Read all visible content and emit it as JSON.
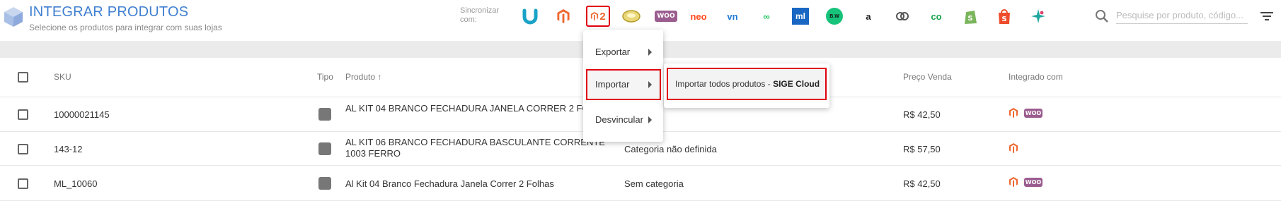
{
  "header": {
    "title": "INTEGRAR PRODUTOS",
    "subtitle": "Selecione os produtos para integrar com suas lojas",
    "sync_label": "Sincronizar com:",
    "search_placeholder": "Pesquise por produto, código..."
  },
  "integrations": [
    {
      "name": "u-icon",
      "text": "",
      "color": "#1aa3c7"
    },
    {
      "name": "magento-icon",
      "text": "",
      "color": "#ee672f"
    },
    {
      "name": "magento2-icon",
      "text": "2",
      "color": "#ee672f"
    },
    {
      "name": "plate-icon",
      "text": "",
      "color": "#d9c24b"
    },
    {
      "name": "woocommerce-icon",
      "text": "WOO",
      "color": "#9b5c8f"
    },
    {
      "name": "neo-icon",
      "text": "neo",
      "color": "#ff4a1c"
    },
    {
      "name": "vn-icon",
      "text": "vn",
      "color": "#1e7bd6"
    },
    {
      "name": "infinity-icon",
      "text": "∞",
      "color": "#1bbf5a"
    },
    {
      "name": "mercadolivre-icon",
      "text": "ml",
      "color": "#1967c2"
    },
    {
      "name": "bw-icon",
      "text": "B.W",
      "color": "#17c37a"
    },
    {
      "name": "amazon-icon",
      "text": "a",
      "color": "#222222"
    },
    {
      "name": "link-icon",
      "text": "",
      "color": "#555555"
    },
    {
      "name": "co-icon",
      "text": "co",
      "color": "#17a34a"
    },
    {
      "name": "shopify-icon",
      "text": "",
      "color": "#7ab55c"
    },
    {
      "name": "shopee-icon",
      "text": "",
      "color": "#ee4d2d"
    },
    {
      "name": "star-icon",
      "text": "",
      "color": "#1fa8a0"
    }
  ],
  "table": {
    "headers": {
      "sku": "SKU",
      "tipo": "Tipo",
      "produto": "Produto ↑",
      "preco": "Preço Venda",
      "integrado": "Integrado com"
    },
    "rows": [
      {
        "sku": "10000021145",
        "produto": "AL KIT 04 BRANCO FECHADURA JANELA CORRER 2 FOLHAS",
        "categoria": "",
        "preco": "R$ 42,50",
        "integrado": [
          "magento",
          "woo"
        ]
      },
      {
        "sku": "143-12",
        "produto": "AL KIT 06 BRANCO FECHADURA BASCULANTE CORRENTE 1003 FERRO",
        "categoria": "Categoria não definida",
        "preco": "R$ 57,50",
        "integrado": [
          "magento"
        ]
      },
      {
        "sku": "ML_10060",
        "produto": "Al Kit 04 Branco Fechadura Janela Correr 2 Folhas",
        "categoria": "Sem categoria",
        "preco": "R$ 42,50",
        "integrado": [
          "magento",
          "woo"
        ]
      }
    ]
  },
  "menu": {
    "exportar": "Exportar",
    "importar": "Importar",
    "desvincular": "Desvincular",
    "submenu_prefix": "Importar todos produtos - ",
    "submenu_bold": "SIGE Cloud"
  },
  "badges": {
    "woo": "WOO"
  }
}
